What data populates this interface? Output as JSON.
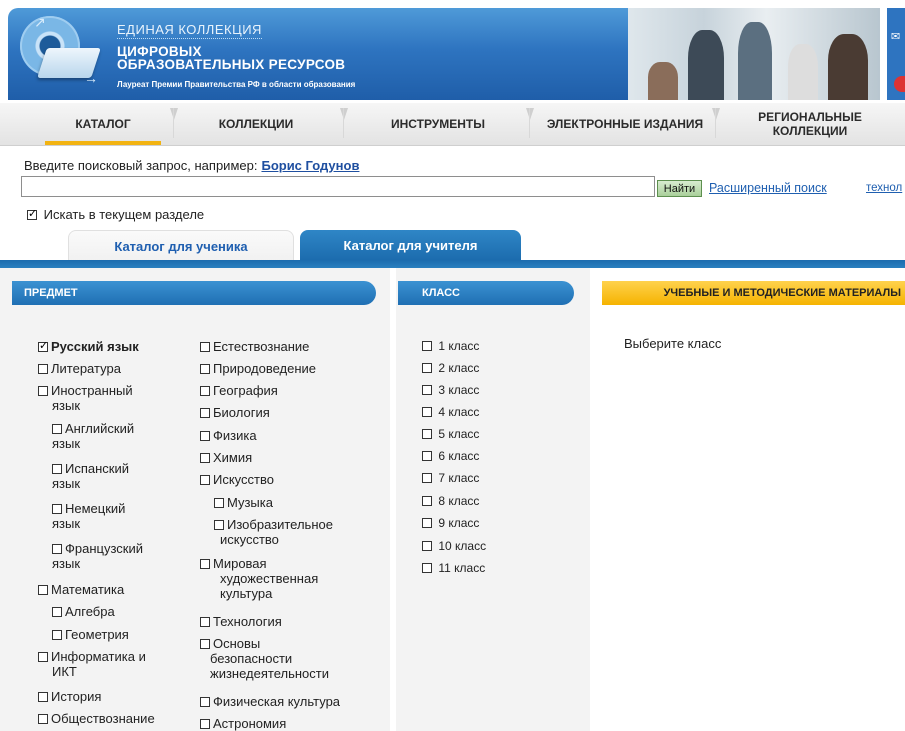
{
  "header": {
    "title_line1": "ЕДИНАЯ КОЛЛЕКЦИЯ",
    "title_line2": "ЦИФРОВЫХ",
    "title_line3": "ОБРАЗОВАТЕЛЬНЫХ РЕСУРСОВ",
    "laureate": "Лауреат Премии Правительства РФ в области образования"
  },
  "nav": {
    "items": [
      {
        "label": "КАТАЛОГ"
      },
      {
        "label": "КОЛЛЕКЦИИ"
      },
      {
        "label": "ИНСТРУМЕНТЫ"
      },
      {
        "label": "ЭЛЕКТРОННЫЕ ИЗДАНИЯ"
      },
      {
        "label_line1": "РЕГИОНАЛЬНЫЕ",
        "label_line2": "КОЛЛЕКЦИИ"
      }
    ]
  },
  "search": {
    "hint": "Введите поисковый запрос, например:",
    "example": "Борис Годунов",
    "value": "",
    "button": "Найти",
    "advanced": "Расширенный поиск",
    "tech": "технол",
    "scope_label": "Искать в текущем разделе",
    "scope_checked": true
  },
  "tabs": {
    "student": "Каталог для ученика",
    "teacher": "Каталог для учителя"
  },
  "panels": {
    "subject_header": "ПРЕДМЕТ",
    "class_header": "КЛАСС",
    "materials_header": "УЧЕБНЫЕ И МЕТОДИЧЕСКИЕ МАТЕРИАЛЫ",
    "materials_hint": "Выберите класс"
  },
  "subjects_col1": [
    {
      "l1": "Русский язык",
      "checked": true
    },
    {
      "l1": "Литература"
    },
    {
      "l1": "Иностранный",
      "l2": "язык"
    },
    {
      "l1": "Английский",
      "l2": "язык"
    },
    {
      "l1": "Испанский",
      "l2": "язык"
    },
    {
      "l1": "Немецкий",
      "l2": "язык"
    },
    {
      "l1": "Французский",
      "l2": "язык"
    },
    {
      "l1": "Математика"
    },
    {
      "l1": "Алгебра"
    },
    {
      "l1": "Геометрия"
    },
    {
      "l1": "Информатика и",
      "l2": "ИКТ"
    },
    {
      "l1": "История"
    },
    {
      "l1": "Обществознание"
    }
  ],
  "subjects_col2": [
    {
      "l1": "Естествознание"
    },
    {
      "l1": "Природоведение"
    },
    {
      "l1": "География"
    },
    {
      "l1": "Биология"
    },
    {
      "l1": "Физика"
    },
    {
      "l1": "Химия"
    },
    {
      "l1": "Искусство"
    },
    {
      "l1": "Музыка"
    },
    {
      "l1": "Изобразительное",
      "l2": "искусство"
    },
    {
      "l1": "Мировая",
      "l2": "художественная",
      "l3": "культура"
    },
    {
      "l1": "Технология"
    },
    {
      "l1": "Основы",
      "l2": "безопасности",
      "l3": "жизнедеятельности"
    },
    {
      "l1": "Физическая культура"
    },
    {
      "l1": "Астрономия"
    }
  ],
  "classes": [
    "1 класс",
    "2 класс",
    "3 класс",
    "4 класс",
    "5 класс",
    "6 класс",
    "7 класс",
    "8 класс",
    "9 класс",
    "10 класс",
    "11 класс"
  ]
}
